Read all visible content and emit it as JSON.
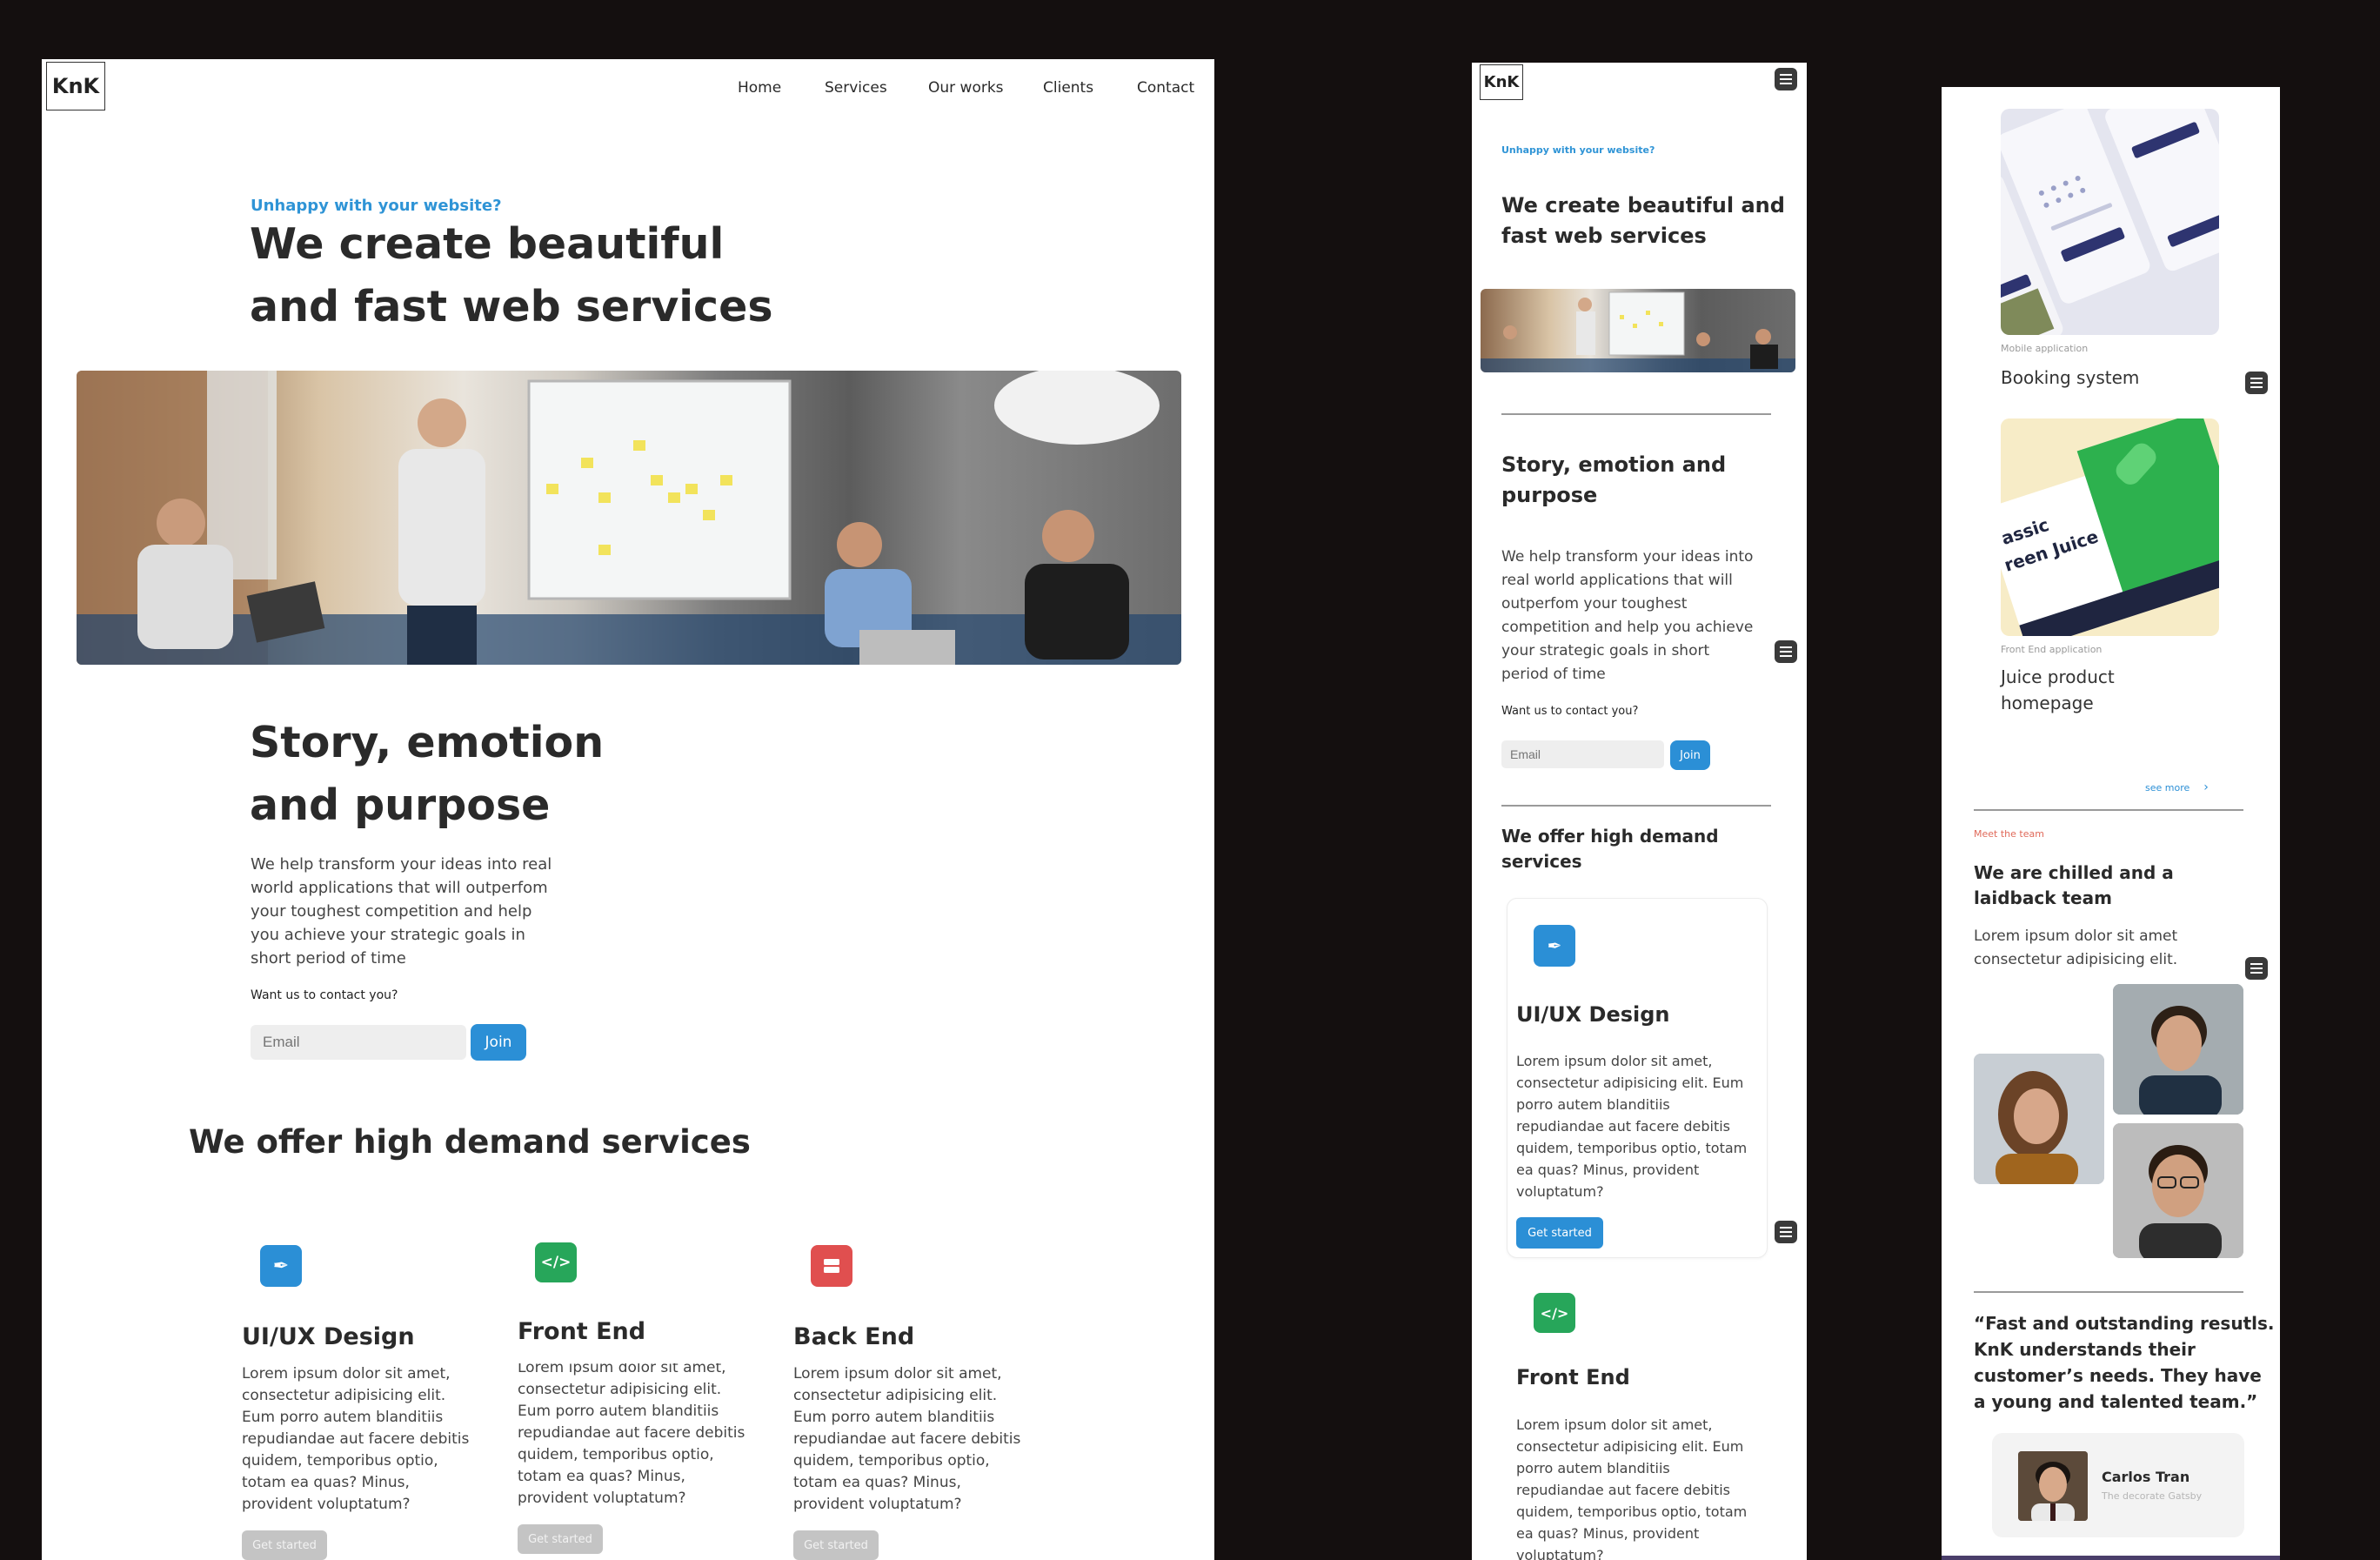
{
  "brand": {
    "logo": "KnK"
  },
  "nav": {
    "items": [
      "Home",
      "Services",
      "Our works",
      "Clients",
      "Contact"
    ]
  },
  "hero": {
    "eyebrow": "Unhappy with your website?",
    "title_line1": "We create beautiful",
    "title_line2": "and fast web services",
    "mobile_title_line1": "We create beautiful and",
    "mobile_title_line2": "fast web services"
  },
  "story": {
    "title_line1": "Story, emotion",
    "title_line2": "and purpose",
    "mobile_title_line1": "Story, emotion and",
    "mobile_title_line2": "purpose",
    "body_desktop": [
      "We help transform your ideas into real",
      "world applications that will outperfom",
      "your toughest competition and help",
      "you achieve your strategic goals in",
      "short period of time"
    ],
    "body_mobile": [
      "We help transform your ideas into",
      "real world applications that will",
      "outperfom your toughest",
      "competition and help you achieve",
      "your strategic goals in short",
      "period of time"
    ],
    "contact_prompt": "Want us to contact you?",
    "email_placeholder": "Email",
    "join_label": "Join"
  },
  "services": {
    "title": "We offer high demand services",
    "mobile_title_line1": "We offer high demand",
    "mobile_title_line2": "services",
    "cta": "Get started",
    "items": [
      {
        "name": "UI/UX Design",
        "icon": "pen-nib-icon",
        "color": "#2b8fd6",
        "lines": [
          "Lorem ipsum dolor sit amet,",
          "consectetur adipisicing elit.",
          "Eum porro autem blanditiis",
          "repudiandae aut facere debitis",
          "quidem, temporibus optio,",
          "totam ea quas? Minus,",
          "provident voluptatum?"
        ]
      },
      {
        "name": "Front End",
        "icon": "code-icon",
        "color": "#27a65a",
        "lines": [
          "Lorem ipsum dolor sit amet,",
          "consectetur adipisicing elit.",
          "Eum porro autem blanditiis",
          "repudiandae aut facere debitis",
          "quidem, temporibus optio,",
          "totam ea quas? Minus,",
          "provident voluptatum?"
        ]
      },
      {
        "name": "Back End",
        "icon": "server-icon",
        "color": "#e04f4f",
        "lines": [
          "Lorem ipsum dolor sit amet,",
          "consectetur adipisicing elit.",
          "Eum porro autem blanditiis",
          "repudiandae aut facere debitis",
          "quidem, temporibus optio,",
          "totam ea quas? Minus,",
          "provident voluptatum?"
        ]
      }
    ],
    "mobile_lines": [
      "Lorem ipsum dolor sit amet,",
      "consectetur adipisicing elit. Eum",
      "porro autem blanditiis",
      "repudiandae aut facere debitis",
      "quidem, temporibus optio, totam",
      "ea quas? Minus, provident",
      "voluptatum?"
    ]
  },
  "works": {
    "items": [
      {
        "category": "Mobile application",
        "title": "Booking system"
      },
      {
        "category": "Front End application",
        "title_line1": "Juice product",
        "title_line2": "homepage"
      }
    ],
    "see_more": "see more",
    "juice_text_1": "assic",
    "juice_text_2": "reen Juice"
  },
  "team": {
    "eyebrow": "Meet the team",
    "title_line1": "We are chilled and a",
    "title_line2": "laidback team",
    "body_line1": "Lorem ipsum dolor sit amet",
    "body_line2": "consectetur adipisicing elit."
  },
  "testimonial": {
    "quote_lines": [
      "“Fast and outstanding resutls.",
      "KnK understands their",
      "customer’s needs. They have",
      "a young and talented team.”"
    ],
    "author": "Carlos Tran",
    "role": "The decorate Gatsby"
  },
  "colors": {
    "accent_blue": "#2b8fd6",
    "accent_green": "#27a65a",
    "accent_red": "#e04f4f",
    "background": "#140f0f",
    "eyebrow_red": "#e06a5a"
  }
}
